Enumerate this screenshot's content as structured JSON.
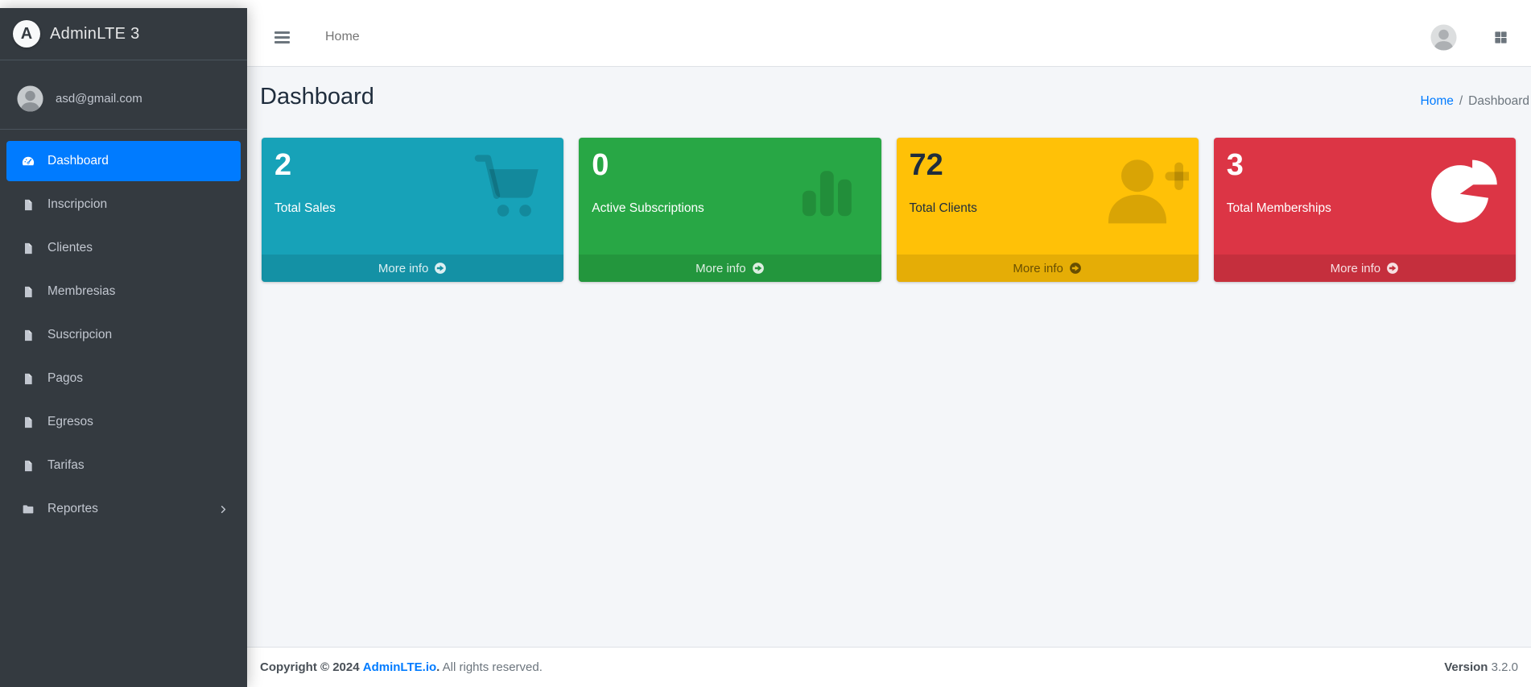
{
  "brand": {
    "title": "AdminLTE 3"
  },
  "user": {
    "email": "asd@gmail.com"
  },
  "sidebar": {
    "items": [
      {
        "label": "Dashboard",
        "icon": "tachometer-icon",
        "active": true
      },
      {
        "label": "Inscripcion",
        "icon": "file-icon"
      },
      {
        "label": "Clientes",
        "icon": "file-icon"
      },
      {
        "label": "Membresias",
        "icon": "file-icon"
      },
      {
        "label": "Suscripcion",
        "icon": "file-icon"
      },
      {
        "label": "Pagos",
        "icon": "file-icon"
      },
      {
        "label": "Egresos",
        "icon": "file-icon"
      },
      {
        "label": "Tarifas",
        "icon": "file-icon"
      },
      {
        "label": "Reportes",
        "icon": "folder-icon",
        "has_children": true
      }
    ],
    "active_color": "#007bff",
    "background": "#343a40"
  },
  "navbar": {
    "home_label": "Home"
  },
  "content": {
    "title": "Dashboard",
    "breadcrumb": {
      "home": "Home",
      "separator": "/",
      "current": "Dashboard"
    }
  },
  "info_boxes": [
    {
      "value": "2",
      "label": "Total Sales",
      "more_label": "More info",
      "icon": "shopping-cart-icon",
      "color": "#17a2b8"
    },
    {
      "value": "0",
      "label": "Active Subscriptions",
      "more_label": "More info",
      "icon": "bar-chart-icon",
      "color": "#28a745"
    },
    {
      "value": "72",
      "label": "Total Clients",
      "more_label": "More info",
      "icon": "user-plus-icon",
      "color": "#ffc107"
    },
    {
      "value": "3",
      "label": "Total Memberships",
      "more_label": "More info",
      "icon": "pie-chart-icon",
      "color": "#dc3545"
    }
  ],
  "footer": {
    "copyright": "Copyright © 2024",
    "link": "AdminLTE.io",
    "rights": "All rights reserved.",
    "version_label": "Version",
    "version_value": "3.2.0"
  }
}
